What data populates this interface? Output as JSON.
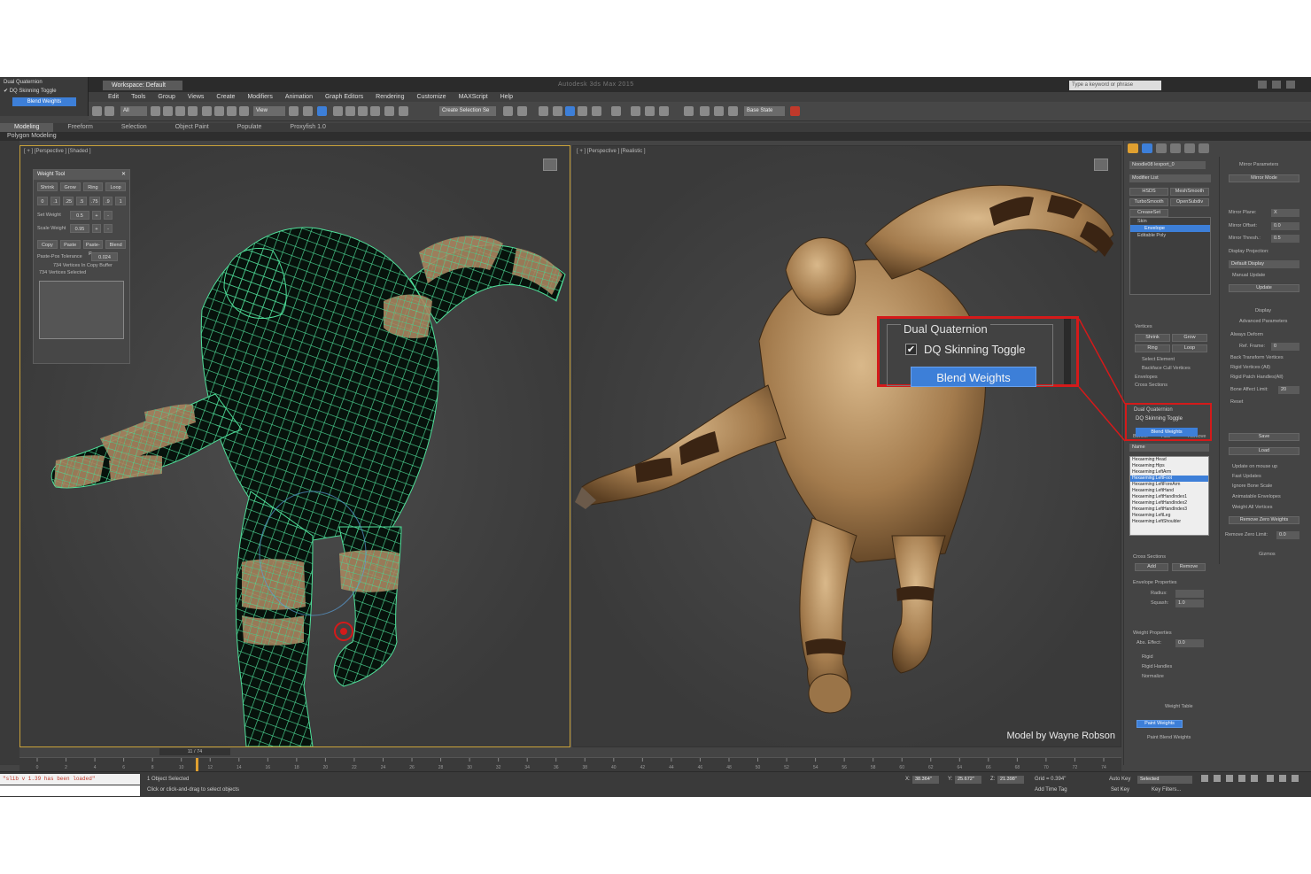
{
  "titlebar": {
    "workspace": "Workspace: Default",
    "app_title": "Autodesk 3ds Max 2015",
    "search_placeholder": "Type a keyword or phrase"
  },
  "dq_mini": {
    "title": "Dual Quaternion",
    "checkbox": "DQ Skinning Toggle",
    "button": "Blend Weights"
  },
  "menu": [
    "Edit",
    "Tools",
    "Group",
    "Views",
    "Create",
    "Modifiers",
    "Animation",
    "Graph Editors",
    "Rendering",
    "Customize",
    "MAXScript",
    "Help"
  ],
  "toolbar": {
    "filter": "All",
    "ref_coord": "View",
    "selection_set": "Create Selection Se",
    "scene_state": "Base State"
  },
  "ribbon": {
    "tabs": [
      "Modeling",
      "Freeform",
      "Selection",
      "Object Paint",
      "Populate",
      "Proxyfish 1.0"
    ],
    "sub": "Polygon Modeling"
  },
  "viewport_left": {
    "label": "[ + ] [Perspective ] [Shaded ]"
  },
  "viewport_right": {
    "label": "[ + ] [Perspective ] [Realistic ]",
    "credit": "Model by Wayne Robson"
  },
  "weight_tool": {
    "title": "Weight Tool",
    "row1": [
      "Shrink",
      "Grow",
      "Ring",
      "Loop"
    ],
    "row2": [
      "0",
      ".1",
      ".25",
      ".5",
      ".75",
      ".9",
      "1"
    ],
    "set_weight_label": "Set Weight",
    "set_weight_value": "0.5",
    "scale_weight_label": "Scale Weight",
    "scale_weight_value": "0.95",
    "row3": [
      "Copy",
      "Paste",
      "Paste-Pos",
      "Blend"
    ],
    "tolerance_label": "Paste-Pos Tolerance",
    "tolerance_value": "0.024",
    "buffer_text": "734 Vertices In Copy Buffer",
    "selected_text": "734 Vertices Selected"
  },
  "callout": {
    "group_title": "Dual Quaternion",
    "checkbox_label": "DQ Skinning Toggle",
    "check_mark": "✔",
    "button_label": "Blend Weights"
  },
  "command_panel": {
    "object_name": "Noodle08 lexport_0",
    "modifier_list": "Modifier List",
    "buttons": [
      "HSDS",
      "MeshSmooth",
      "TurboSmooth",
      "OpenSubdiv",
      "CreaseSet"
    ],
    "stack": [
      "Skin",
      "Envelope",
      "Editable Poly"
    ],
    "vertices": "Vertices",
    "shrink": "Shrink",
    "grow": "Grow",
    "ring": "Ring",
    "loop": "Loop",
    "select_element": "Select Element",
    "backface": "Backface Cull Vertices",
    "envelopes": "Envelopes",
    "cross_sections": "Cross Sections",
    "dq_title": "Dual Quaternion",
    "dq_check": "DQ Skinning Toggle",
    "dq_button": "Blend Weights",
    "bones_label": "Bones:",
    "bones_add": "Add",
    "bones_remove": "Remove",
    "name_label": "Name",
    "bones": [
      "Hexaeming:Head",
      "Hexaeming:Hips",
      "Hexaeming:LeftArm",
      "Hexaeming:LeftFoot",
      "Hexaeming:LeftForeArm",
      "Hexaeming:LeftHand",
      "Hexaeming:LeftHandIndex1",
      "Hexaeming:LeftHandIndex2",
      "Hexaeming:LeftHandIndex3",
      "Hexaeming:LeftLeg",
      "Hexaeming:LeftShoulder"
    ],
    "cs_title": "Cross Sections",
    "cs_add": "Add",
    "cs_remove": "Remove",
    "env_title": "Envelope Properties",
    "radius": "Radius:",
    "squash": "Squash:",
    "squash_value": "1.0",
    "wp_title": "Weight Properties",
    "abs_effect": "Abs. Effect:",
    "abs_value": "0.0",
    "rigid": "Rigid",
    "rigid_handles": "Rigid Handles",
    "normalize": "Normalize",
    "weight_table": "Weight Table",
    "paint_weights": "Paint Weights",
    "paint_blend": "Paint Blend Weights"
  },
  "mirror_panel": {
    "title": "Mirror Parameters",
    "mirror_mode": "Mirror Mode",
    "mirror_plane": "Mirror Plane:",
    "mirror_plane_value": "X",
    "mirror_offset": "Mirror Offset:",
    "mirror_offset_value": "0.0",
    "mirror_thresh": "Mirror Thresh.:",
    "mirror_thresh_value": "0.5",
    "display_projection": "Display Projection:",
    "projection_value": "Default Display",
    "manual_update": "Manual Update",
    "update": "Update",
    "display": "Display",
    "advanced": "Advanced Parameters",
    "always_deform": "Always Deform",
    "ref_frame": "Ref. Frame:",
    "ref_frame_value": "0",
    "back_transform": "Back Transform Vertices",
    "rigid_vertices": "Rigid Vertices (All)",
    "rigid_patch": "Rigid Patch Handles(All)",
    "bone_affect": "Bone Affect Limit:",
    "bone_affect_value": "20",
    "reset": "Reset",
    "save": "Save",
    "load": "Load",
    "update_mouse": "Update on mouse up",
    "fast_updates": "Fast Updates",
    "ignore_bone": "Ignore Bone Scale",
    "animatable": "Animatable Envelopes",
    "weight_all": "Weight All Vertices",
    "remove_zero": "Remove Zero Weights",
    "remove_limit": "Remove Zero Limit:",
    "remove_limit_value": "0.0",
    "gizmos": "Gizmos"
  },
  "timeline": {
    "frame": "11 / 74",
    "ticks": [
      "0",
      "2",
      "4",
      "6",
      "8",
      "10",
      "12",
      "14",
      "16",
      "18",
      "20",
      "22",
      "24",
      "26",
      "28",
      "30",
      "32",
      "34",
      "36",
      "38",
      "40",
      "42",
      "44",
      "46",
      "48",
      "50",
      "52",
      "54",
      "56",
      "58",
      "60",
      "62",
      "64",
      "66",
      "68",
      "70",
      "72",
      "74"
    ]
  },
  "status": {
    "script_line": "\"slib v 1.39 has been loaded\"",
    "selected": "1 Object Selected",
    "hint": "Click or click-and-drag to select objects",
    "x_label": "X:",
    "x_value": "38.364\"",
    "y_label": "Y:",
    "y_value": "25.672\"",
    "z_label": "Z:",
    "z_value": "21.398\"",
    "grid": "Grid = 0.394\"",
    "add_time_tag": "Add Time Tag",
    "auto_key": "Auto Key",
    "set_key": "Set Key",
    "key_mode": "Selected",
    "key_filters": "Key Filters..."
  },
  "colors": {
    "accent_blue": "#3d7fd8",
    "callout_red": "#d41a1a",
    "wire_green": "#4fe09a",
    "skin_tan": "#b08a5a"
  }
}
